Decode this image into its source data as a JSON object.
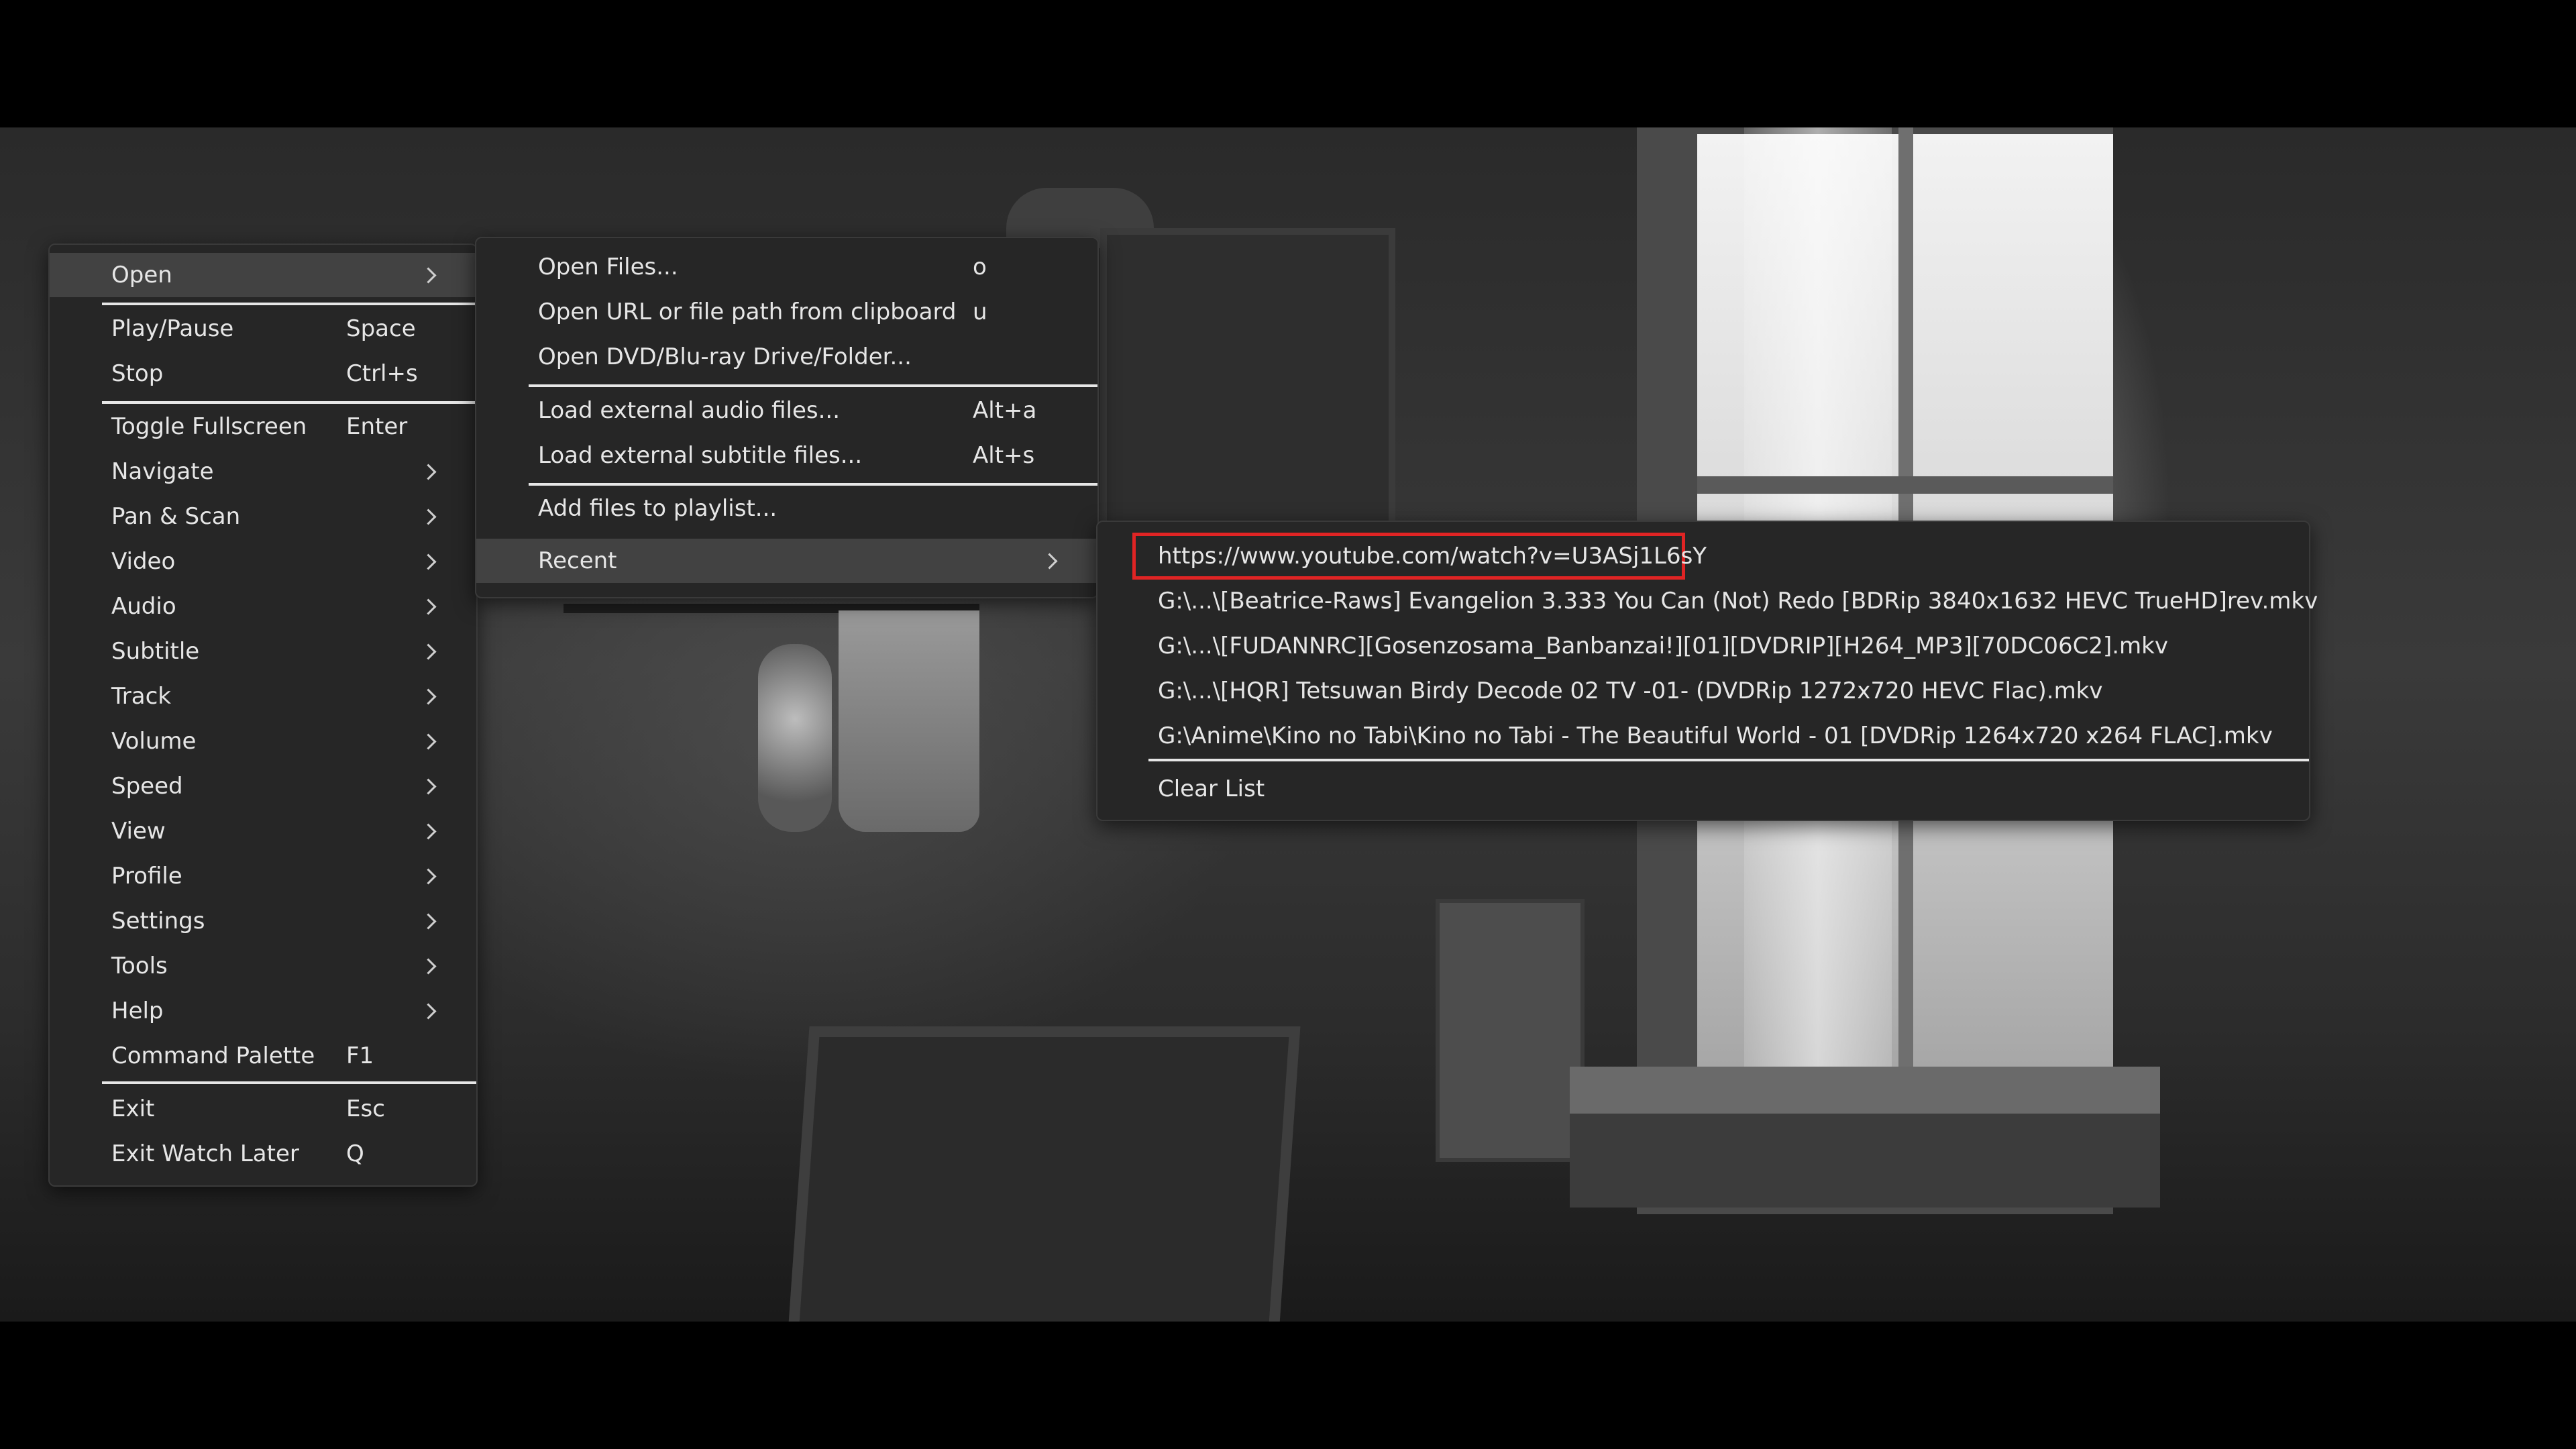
{
  "main_menu": {
    "items": [
      {
        "label": "Open",
        "shortcut": "",
        "submenu": true
      },
      {
        "label": "Play/Pause",
        "shortcut": "Space",
        "submenu": false
      },
      {
        "label": "Stop",
        "shortcut": "Ctrl+s",
        "submenu": false
      },
      {
        "label": "Toggle Fullscreen",
        "shortcut": "Enter",
        "submenu": false
      },
      {
        "label": "Navigate",
        "shortcut": "",
        "submenu": true
      },
      {
        "label": "Pan & Scan",
        "shortcut": "",
        "submenu": true
      },
      {
        "label": "Video",
        "shortcut": "",
        "submenu": true
      },
      {
        "label": "Audio",
        "shortcut": "",
        "submenu": true
      },
      {
        "label": "Subtitle",
        "shortcut": "",
        "submenu": true
      },
      {
        "label": "Track",
        "shortcut": "",
        "submenu": true
      },
      {
        "label": "Volume",
        "shortcut": "",
        "submenu": true
      },
      {
        "label": "Speed",
        "shortcut": "",
        "submenu": true
      },
      {
        "label": "View",
        "shortcut": "",
        "submenu": true
      },
      {
        "label": "Profile",
        "shortcut": "",
        "submenu": true
      },
      {
        "label": "Settings",
        "shortcut": "",
        "submenu": true
      },
      {
        "label": "Tools",
        "shortcut": "",
        "submenu": true
      },
      {
        "label": "Help",
        "shortcut": "",
        "submenu": true
      },
      {
        "label": "Command Palette",
        "shortcut": "F1",
        "submenu": false
      },
      {
        "label": "Exit",
        "shortcut": "Esc",
        "submenu": false
      },
      {
        "label": "Exit Watch Later",
        "shortcut": "Q",
        "submenu": false
      }
    ]
  },
  "open_menu": {
    "items": [
      {
        "label": "Open Files...",
        "shortcut": "o"
      },
      {
        "label": "Open URL or file path from clipboard",
        "shortcut": "u"
      },
      {
        "label": "Open DVD/Blu-ray Drive/Folder...",
        "shortcut": ""
      },
      {
        "label": "Load external audio files...",
        "shortcut": "Alt+a"
      },
      {
        "label": "Load external subtitle files...",
        "shortcut": "Alt+s"
      },
      {
        "label": "Add files to playlist...",
        "shortcut": ""
      },
      {
        "label": "Recent",
        "shortcut": ""
      }
    ]
  },
  "recent_menu": {
    "items": [
      "https://www.youtube.com/watch?v=U3ASj1L6sY",
      "G:\\...\\[Beatrice-Raws] Evangelion 3.333 You Can (Not) Redo [BDRip 3840x1632 HEVC TrueHD]rev.mkv",
      "G:\\...\\[FUDANNRC][Gosenzosama_Banbanzai!][01][DVDRIP][H264_MP3][70DC06C2].mkv",
      "G:\\...\\[HQR] Tetsuwan Birdy Decode 02 TV -01- (DVDRip 1272x720 HEVC Flac).mkv",
      "G:\\Anime\\Kino no Tabi\\Kino no Tabi - The Beautiful World - 01 [DVDRip 1264x720 x264 FLAC].mkv"
    ],
    "clear_label": "Clear List"
  },
  "colors": {
    "menu_bg": "#262626",
    "highlight": "#424242",
    "text": "#e6e6e6",
    "url_outline": "#e02424"
  }
}
